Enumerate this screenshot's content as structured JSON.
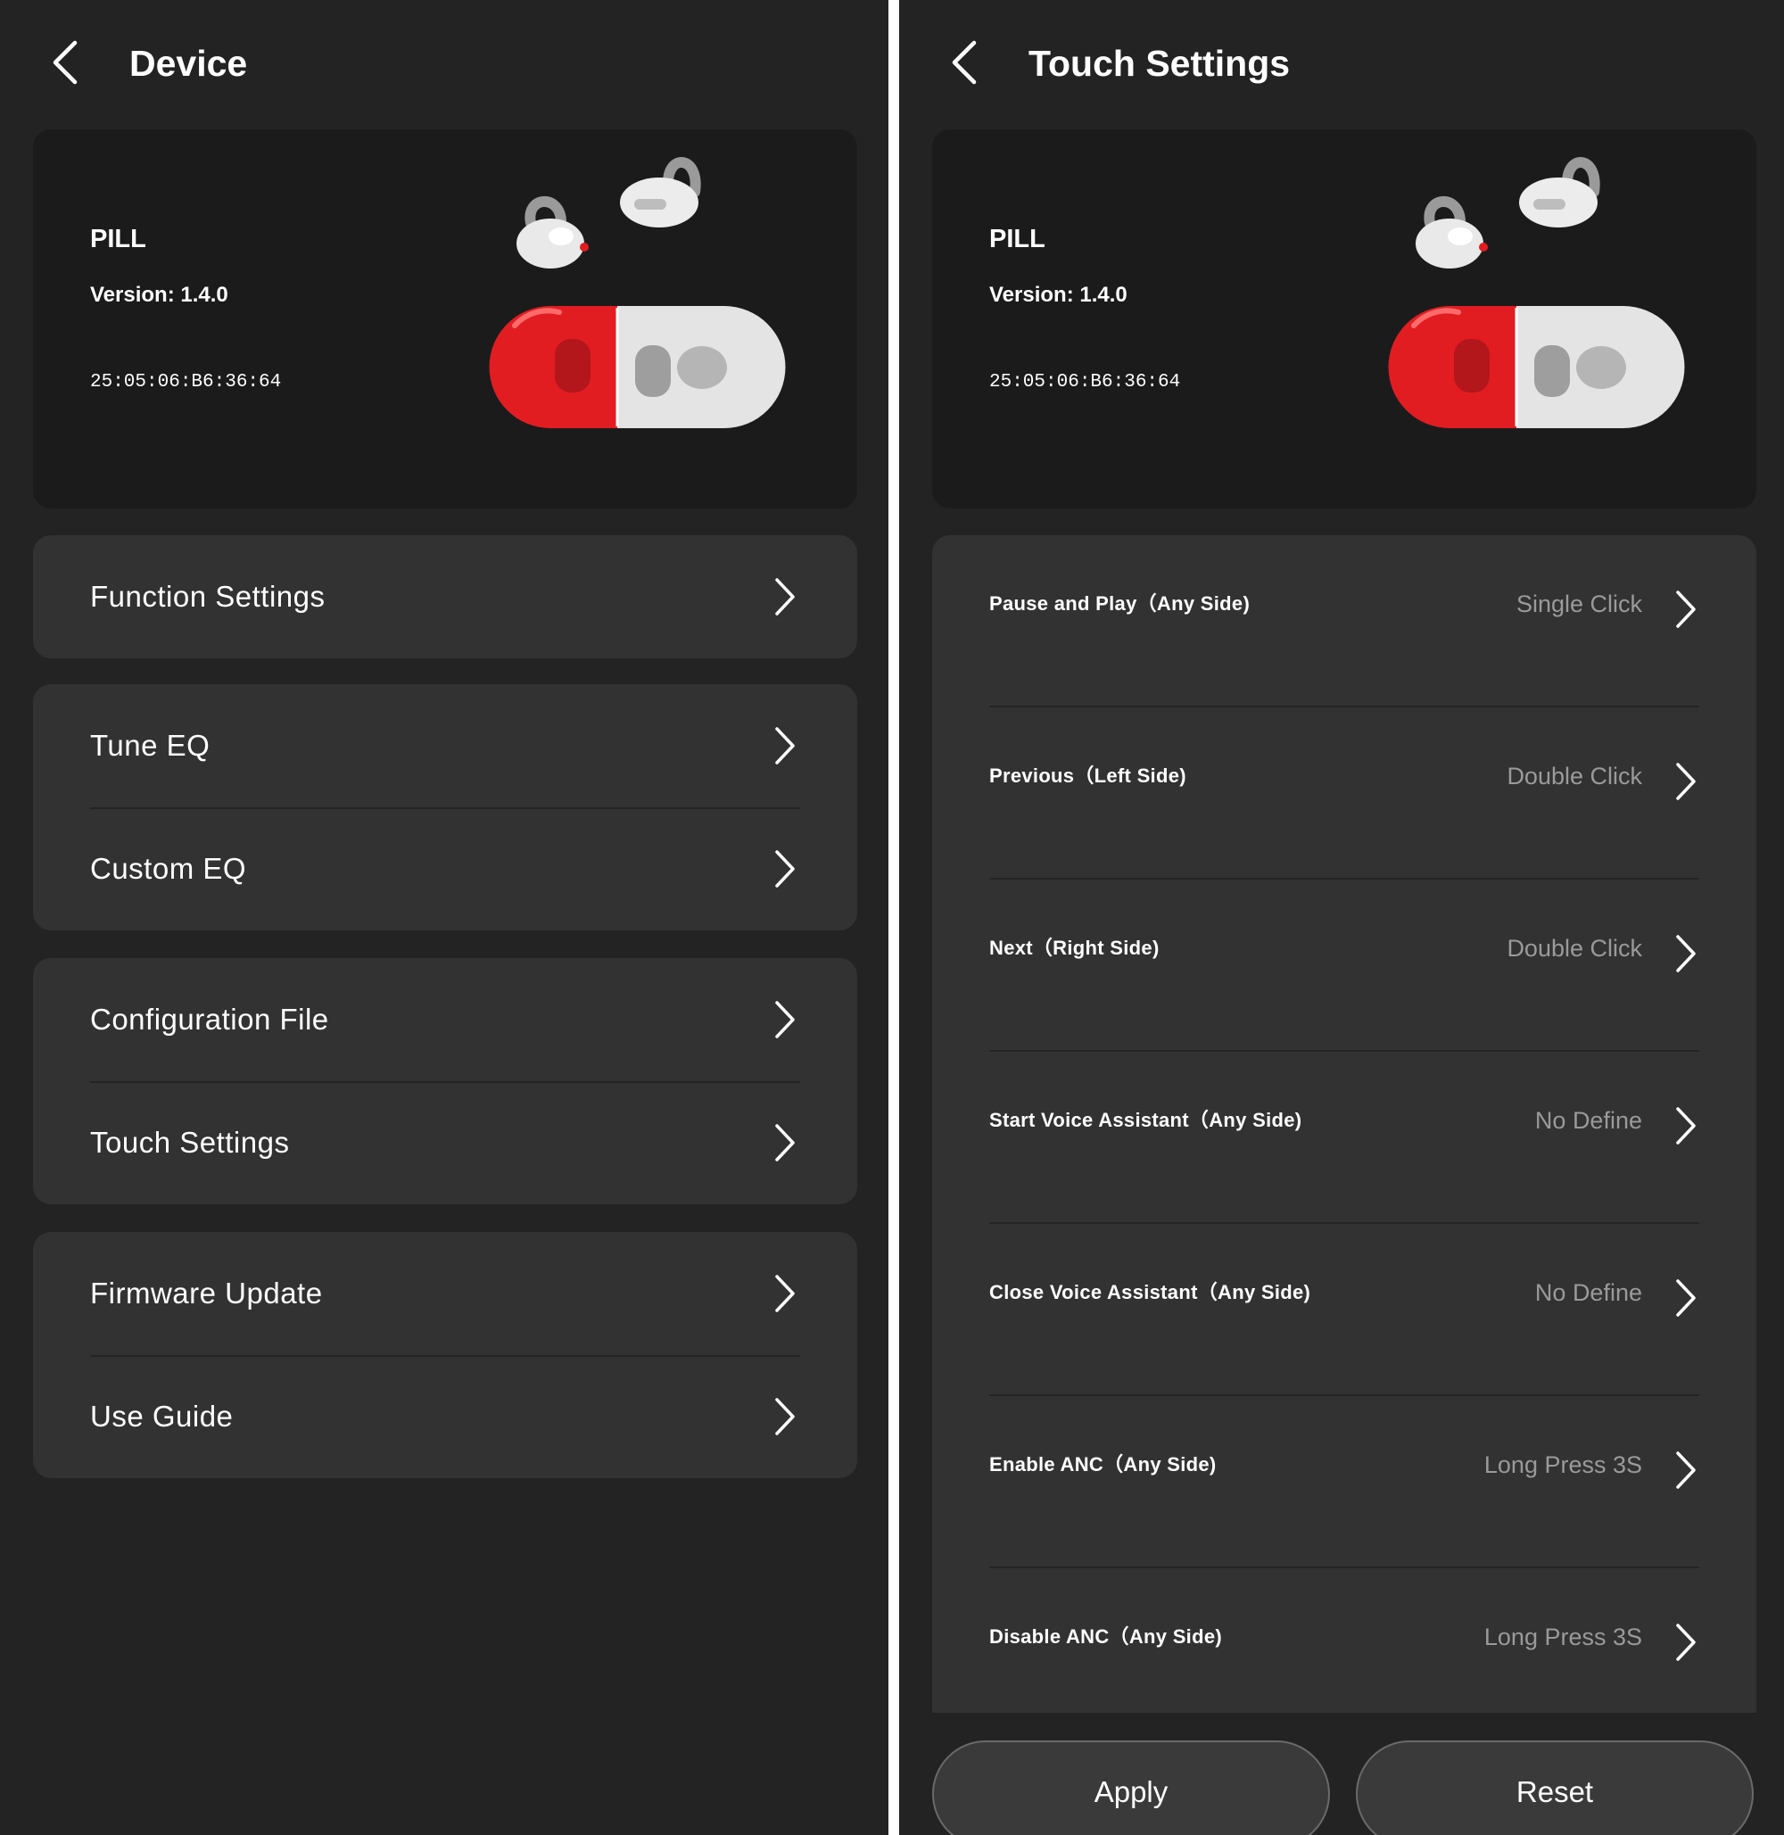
{
  "colors": {
    "background": "#232323",
    "card": "#1b1b1b",
    "group": "#323232",
    "divider": "#242424",
    "text": "#ffffff",
    "value_text": "#9a9a9a",
    "case_red": "#e11d22",
    "button": "#3a3a3a"
  },
  "device": {
    "name": "PILL",
    "version": "Version: 1.4.0",
    "mac": "25:05:06:B6:36:64"
  },
  "left": {
    "title": "Device",
    "back_icon": "chevron-left-icon",
    "groups": [
      {
        "items": [
          {
            "label": "Function Settings"
          }
        ]
      },
      {
        "items": [
          {
            "label": "Tune EQ"
          },
          {
            "label": "Custom EQ"
          }
        ]
      },
      {
        "items": [
          {
            "label": "Configuration File"
          },
          {
            "label": "Touch Settings"
          }
        ]
      },
      {
        "items": [
          {
            "label": "Firmware Update"
          },
          {
            "label": "Use Guide"
          }
        ]
      }
    ]
  },
  "right": {
    "title": "Touch Settings",
    "back_icon": "chevron-left-icon",
    "rows": [
      {
        "label": "Pause and Play（Any Side)",
        "value": "Single Click"
      },
      {
        "label": "Previous（Left Side)",
        "value": "Double Click"
      },
      {
        "label": "Next（Right Side)",
        "value": "Double Click"
      },
      {
        "label": "Start Voice Assistant（Any Side)",
        "value": "No Define"
      },
      {
        "label": "Close Voice Assistant（Any Side)",
        "value": "No Define"
      },
      {
        "label": "Enable ANC（Any Side)",
        "value": "Long Press 3S"
      },
      {
        "label": "Disable ANC（Any Side)",
        "value": "Long Press 3S"
      }
    ],
    "apply_label": "Apply",
    "reset_label": "Reset"
  }
}
